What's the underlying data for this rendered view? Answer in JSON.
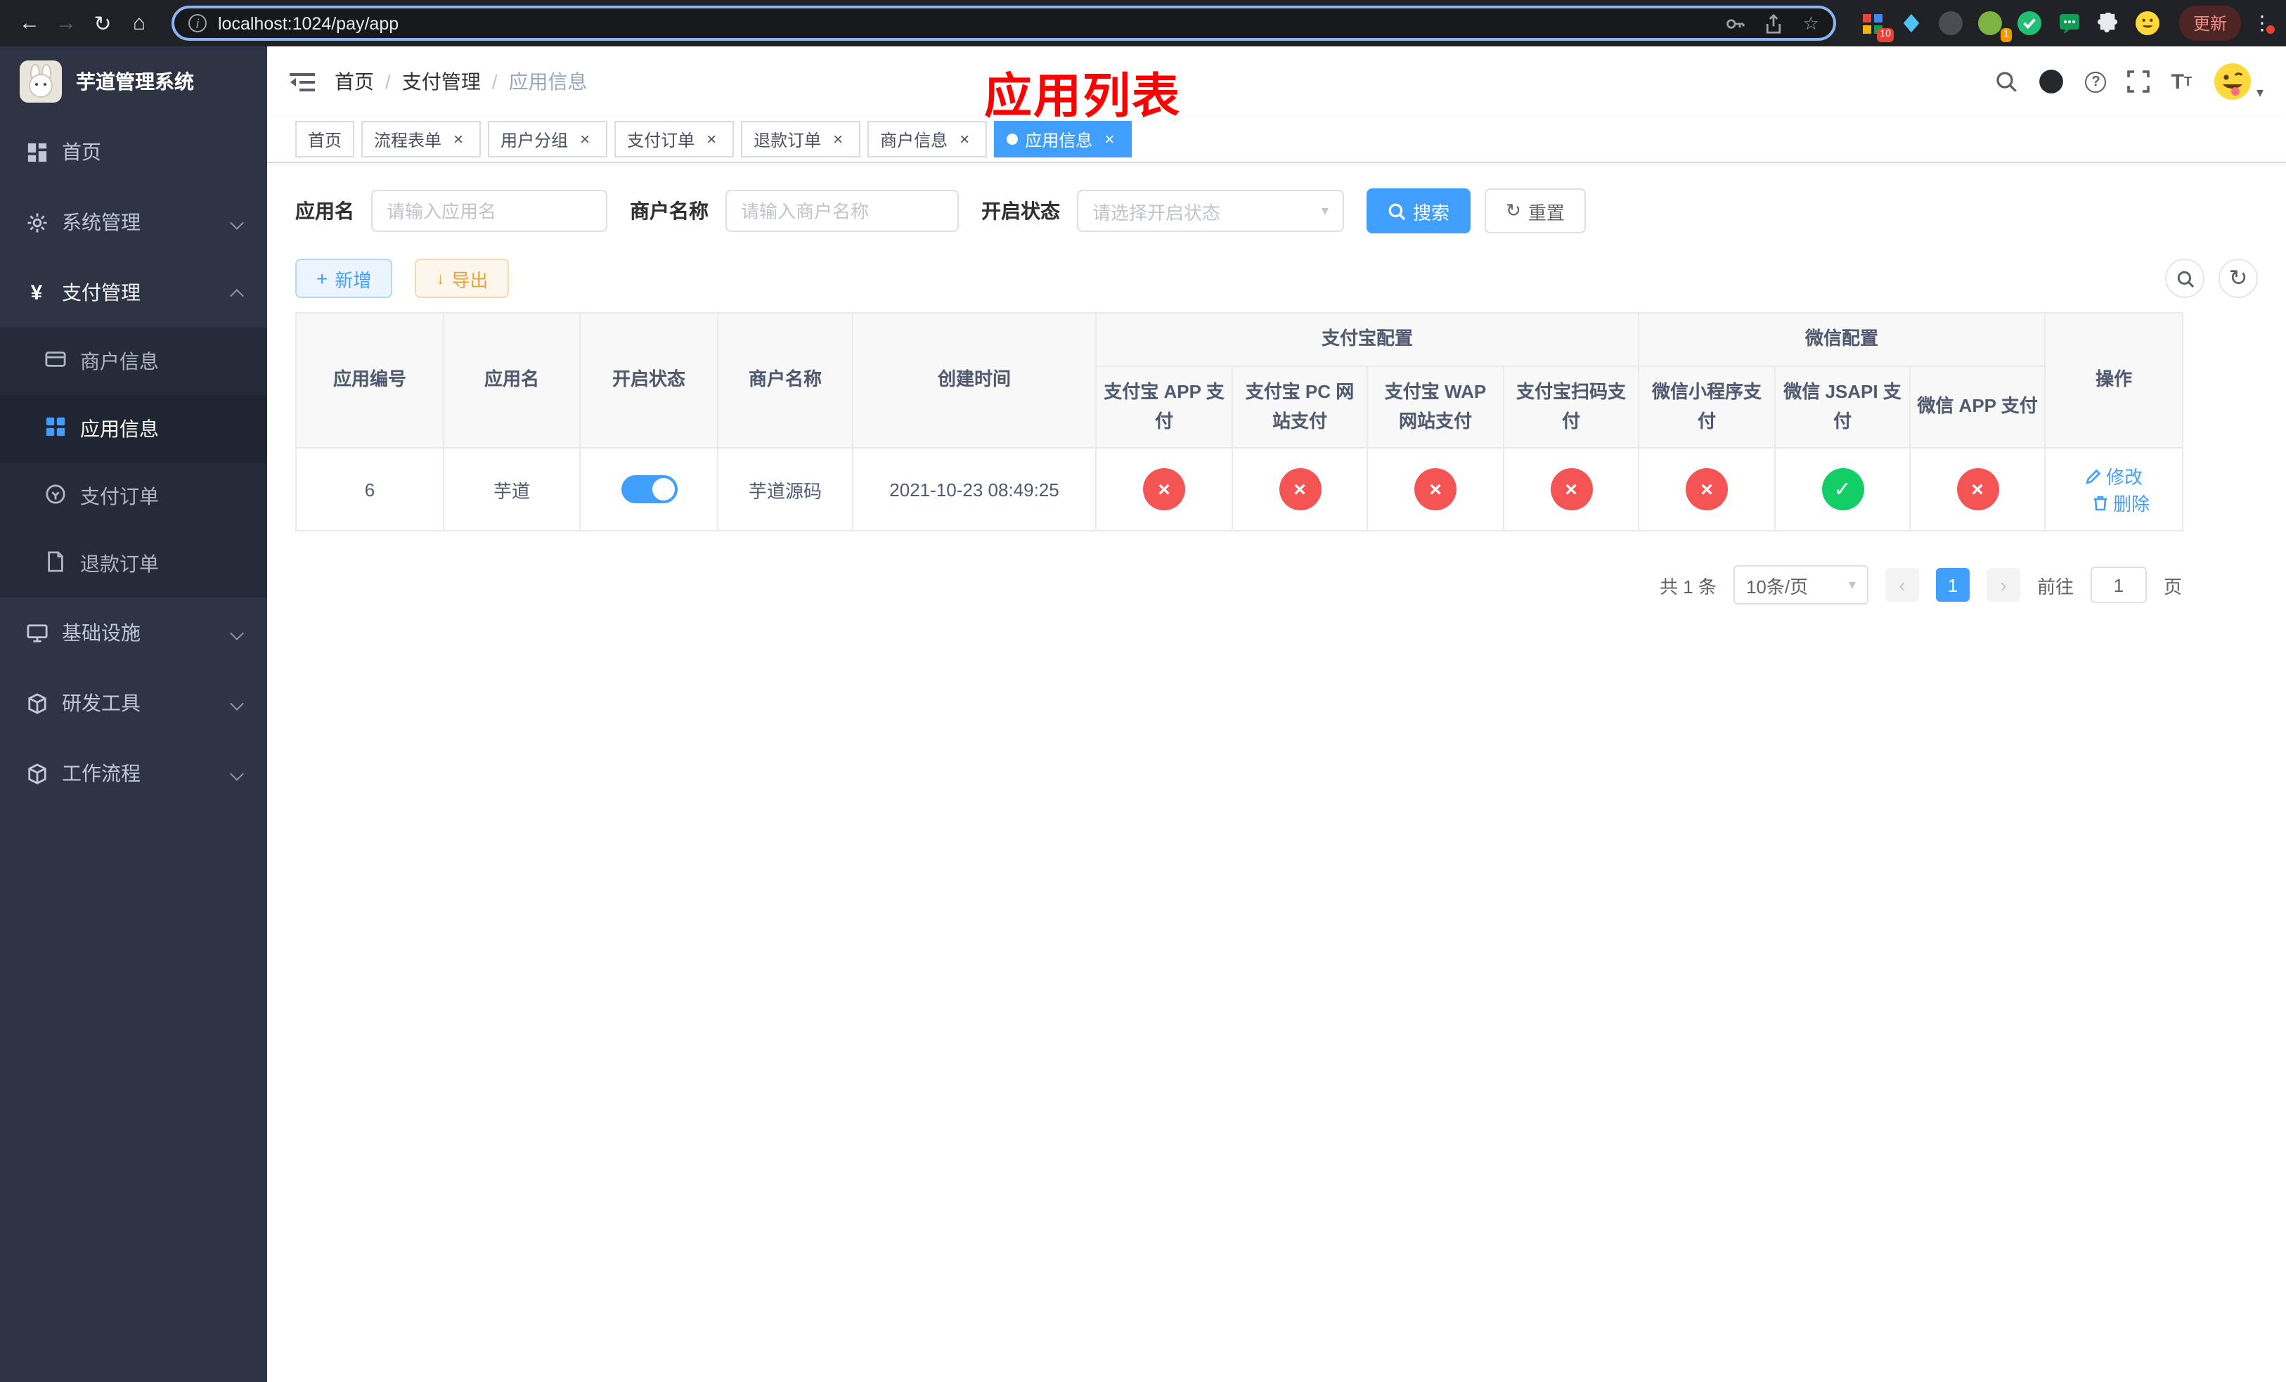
{
  "colors": {
    "accent": "#409eff",
    "danger": "#f45454",
    "success": "#13ce66",
    "warning": "#e6a23c"
  },
  "browser": {
    "url": "localhost:1024/pay/app",
    "update_label": "更新",
    "ext_badge_grid": "10",
    "ext_badge_avatar": "1"
  },
  "sidebar": {
    "logo_title": "芋道管理系统",
    "items": [
      {
        "label": "首页"
      },
      {
        "label": "系统管理"
      },
      {
        "label": "支付管理",
        "children": [
          {
            "label": "商户信息"
          },
          {
            "label": "应用信息"
          },
          {
            "label": "支付订单"
          },
          {
            "label": "退款订单"
          }
        ]
      },
      {
        "label": "基础设施"
      },
      {
        "label": "研发工具"
      },
      {
        "label": "工作流程"
      }
    ]
  },
  "breadcrumb": [
    "首页",
    "支付管理",
    "应用信息"
  ],
  "annotation": "应用列表",
  "tabs": [
    {
      "label": "首页"
    },
    {
      "label": "流程表单"
    },
    {
      "label": "用户分组"
    },
    {
      "label": "支付订单"
    },
    {
      "label": "退款订单"
    },
    {
      "label": "商户信息"
    },
    {
      "label": "应用信息"
    }
  ],
  "filters": {
    "app_name_label": "应用名",
    "app_name_placeholder": "请输入应用名",
    "merchant_name_label": "商户名称",
    "merchant_name_placeholder": "请输入商户名称",
    "status_label": "开启状态",
    "status_placeholder": "请选择开启状态",
    "search_label": "搜索",
    "reset_label": "重置"
  },
  "toolbar": {
    "add_label": "新增",
    "export_label": "导出"
  },
  "table": {
    "headers": {
      "app_id": "应用编号",
      "app_name": "应用名",
      "status": "开启状态",
      "merchant_name": "商户名称",
      "create_time": "创建时间",
      "alipay_group": "支付宝配置",
      "alipay_app": "支付宝 APP 支付",
      "alipay_pc": "支付宝 PC 网站支付",
      "alipay_wap": "支付宝 WAP 网站支付",
      "alipay_scan": "支付宝扫码支付",
      "wechat_group": "微信配置",
      "wechat_mini": "微信小程序支付",
      "wechat_jsapi": "微信 JSAPI 支付",
      "wechat_app": "微信 APP 支付",
      "actions": "操作"
    },
    "rows": [
      {
        "app_id": "6",
        "app_name": "芋道",
        "status_on": true,
        "merchant_name": "芋道源码",
        "create_time": "2021-10-23 08:49:25",
        "configs": [
          "no",
          "no",
          "no",
          "no",
          "no",
          "yes",
          "no"
        ],
        "edit_label": "修改",
        "delete_label": "删除"
      }
    ]
  },
  "pagination": {
    "total_text": "共 1 条",
    "page_size": "10条/页",
    "current_page": "1",
    "goto_label": "前往",
    "goto_value": "1",
    "page_unit": "页"
  }
}
